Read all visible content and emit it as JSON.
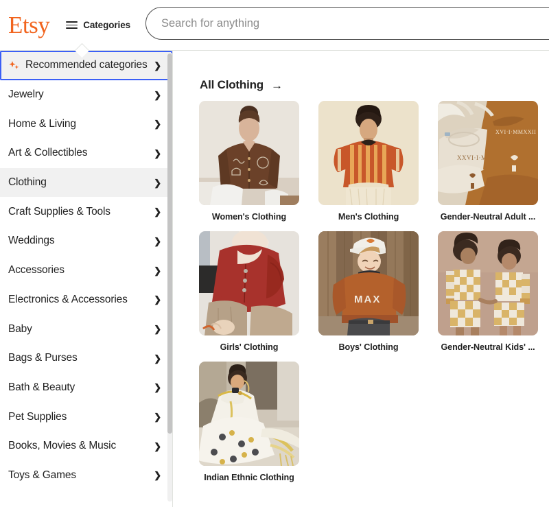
{
  "header": {
    "logo_text": "Etsy",
    "logo_color": "#F1641E",
    "categories_label": "Categories",
    "search_placeholder": "Search for anything",
    "search_value": ""
  },
  "sidebar": {
    "items": [
      {
        "label": "Recommended categories",
        "icon": "sparkle-icon",
        "state": "focused"
      },
      {
        "label": "Jewelry",
        "icon": "",
        "state": ""
      },
      {
        "label": "Home & Living",
        "icon": "",
        "state": ""
      },
      {
        "label": "Art & Collectibles",
        "icon": "",
        "state": ""
      },
      {
        "label": "Clothing",
        "icon": "",
        "state": "selected"
      },
      {
        "label": "Craft Supplies & Tools",
        "icon": "",
        "state": ""
      },
      {
        "label": "Weddings",
        "icon": "",
        "state": ""
      },
      {
        "label": "Accessories",
        "icon": "",
        "state": ""
      },
      {
        "label": "Electronics & Accessories",
        "icon": "",
        "state": ""
      },
      {
        "label": "Baby",
        "icon": "",
        "state": ""
      },
      {
        "label": "Bags & Purses",
        "icon": "",
        "state": ""
      },
      {
        "label": "Bath & Beauty",
        "icon": "",
        "state": ""
      },
      {
        "label": "Pet Supplies",
        "icon": "",
        "state": ""
      },
      {
        "label": "Books, Movies & Music",
        "icon": "",
        "state": ""
      },
      {
        "label": "Toys & Games",
        "icon": "",
        "state": ""
      }
    ],
    "chevron_glyph": "❯"
  },
  "main": {
    "section_title": "All Clothing",
    "section_arrow": "→",
    "cards": [
      {
        "label": "Women's Clothing",
        "image": "woman-brown-embroidered-shirt"
      },
      {
        "label": "Men's Clothing",
        "image": "man-rust-striped-sweater"
      },
      {
        "label": "Gender-Neutral Adult ...",
        "image": "embroidered-sweatshirts-pair"
      },
      {
        "label": "Girls' Clothing",
        "image": "girl-red-blouse"
      },
      {
        "label": "Boys' Clothing",
        "image": "boy-max-sweater"
      },
      {
        "label": "Gender-Neutral Kids' ...",
        "image": "kids-checkered-outfits"
      },
      {
        "label": "Indian Ethnic Clothing",
        "image": "woman-white-gold-saree"
      }
    ]
  }
}
